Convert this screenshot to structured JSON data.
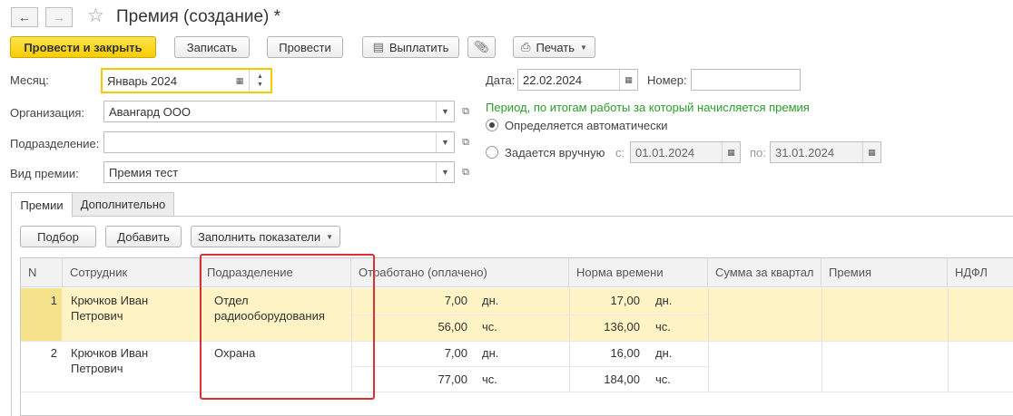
{
  "window": {
    "title": "Премия (создание) *",
    "back_icon": "arrow-left-icon",
    "forward_icon": "arrow-right-icon",
    "favorite_icon": "star-icon"
  },
  "toolbar": {
    "post_close": "Провести и закрыть",
    "save": "Записать",
    "post": "Провести",
    "pay": "Выплатить",
    "attach_icon": "paperclip-icon",
    "print": "Печать"
  },
  "form": {
    "month_label": "Месяц:",
    "month_value": "Январь 2024",
    "date_label": "Дата:",
    "date_value": "22.02.2024",
    "number_label": "Номер:",
    "number_value": "",
    "org_label": "Организация:",
    "org_value": "Авангард ООО",
    "dept_label": "Подразделение:",
    "dept_value": "",
    "bonus_type_label": "Вид премии:",
    "bonus_type_value": "Премия тест",
    "period_hint": "Период, по итогам работы за который начисляется премия",
    "radio_auto": "Определяется автоматически",
    "radio_manual": "Задается вручную",
    "from_label": "с:",
    "from_value": "01.01.2024",
    "to_label": "по:",
    "to_value": "31.01.2024",
    "selected_radio": "auto"
  },
  "tabs": [
    {
      "label": "Премии",
      "active": true
    },
    {
      "label": "Дополнительно",
      "active": false
    }
  ],
  "table_toolbar": {
    "pick": "Подбор",
    "add": "Добавить",
    "fill": "Заполнить показатели"
  },
  "table": {
    "columns": [
      "N",
      "Сотрудник",
      "Подразделение",
      "Отработано (оплачено)",
      "Норма времени",
      "Сумма за квартал",
      "Премия",
      "НДФЛ"
    ],
    "rows": [
      {
        "n": "1",
        "employee_line1": "Крючков Иван",
        "employee_line2": "Петрович",
        "dept_line1": "Отдел",
        "dept_line2": "радиооборудования",
        "worked_days": "7,00",
        "worked_days_unit": "дн.",
        "worked_hours": "56,00",
        "worked_hours_unit": "чс.",
        "norm_days": "17,00",
        "norm_days_unit": "дн.",
        "norm_hours": "136,00",
        "norm_hours_unit": "чс."
      },
      {
        "n": "2",
        "employee_line1": "Крючков Иван",
        "employee_line2": "Петрович",
        "dept_line1": "Охрана",
        "dept_line2": "",
        "worked_days": "7,00",
        "worked_days_unit": "дн.",
        "worked_hours": "77,00",
        "worked_hours_unit": "чс.",
        "norm_days": "16,00",
        "norm_days_unit": "дн.",
        "norm_hours": "184,00",
        "norm_hours_unit": "чс."
      }
    ]
  },
  "colors": {
    "primary_button": "#f7cc00",
    "selected_row": "#fdf3c4",
    "highlight_box": "#d83333",
    "hint_text": "#2a9d2a"
  }
}
